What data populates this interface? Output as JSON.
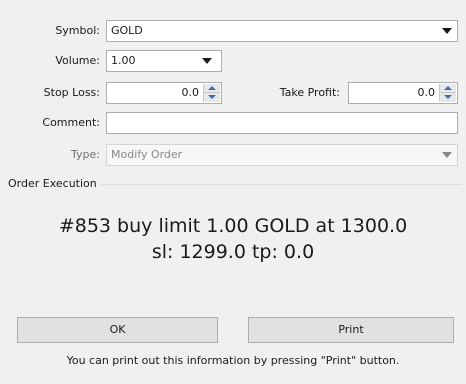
{
  "form": {
    "symbol_label": "Symbol:",
    "symbol_value": "GOLD",
    "volume_label": "Volume:",
    "volume_value": "1.00",
    "stop_loss_label": "Stop Loss:",
    "stop_loss_value": "0.0",
    "take_profit_label": "Take Profit:",
    "take_profit_value": "0.0",
    "comment_label": "Comment:",
    "comment_value": "",
    "type_label": "Type:",
    "type_value": "Modify Order"
  },
  "execution": {
    "group_title": "Order Execution",
    "line1": "#853 buy limit 1.00 GOLD at 1300.0",
    "line2": "sl: 1299.0 tp: 0.0"
  },
  "buttons": {
    "ok_label": "OK",
    "print_label": "Print"
  },
  "footer": {
    "note": "You can print out this information by pressing \"Print\" button."
  },
  "icons": {
    "dropdown": "chevron-down-icon",
    "spin_up": "spin-up-icon",
    "spin_down": "spin-down-icon"
  }
}
